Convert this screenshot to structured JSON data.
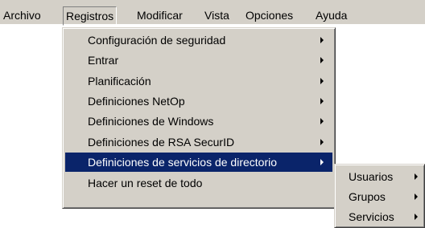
{
  "menubar": {
    "items": [
      {
        "label": "Archivo"
      },
      {
        "label": "Registros"
      },
      {
        "label": "Modificar"
      },
      {
        "label": "Vista"
      },
      {
        "label": "Opciones"
      },
      {
        "label": "Ayuda"
      }
    ]
  },
  "registros_menu": {
    "items": [
      {
        "label": "Configuración de seguridad"
      },
      {
        "label": "Entrar"
      },
      {
        "label": "Planificación"
      },
      {
        "label": "Definiciones NetOp"
      },
      {
        "label": "Definiciones de Windows"
      },
      {
        "label": "Definiciones de RSA SecurID"
      },
      {
        "label": "Definiciones de servicios de directorio"
      },
      {
        "label": "Hacer un reset de todo"
      }
    ],
    "highlighted": "Definiciones de servicios de directorio"
  },
  "submenu": {
    "items": [
      {
        "label": "Usuarios"
      },
      {
        "label": "Grupos"
      },
      {
        "label": "Servicios"
      }
    ]
  },
  "colors": {
    "menu_face": "#d4d0c8",
    "highlight": "#0a246a",
    "highlight_text": "#ffffff"
  },
  "icons": {
    "submenu_arrow": "chevron-right-icon"
  }
}
